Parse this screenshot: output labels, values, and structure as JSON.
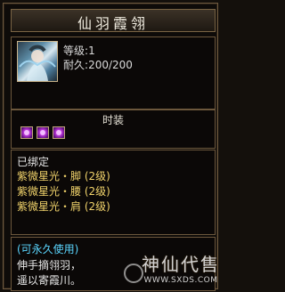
{
  "tooltip": {
    "title": "仙羽霞翎",
    "level_label": "等级",
    "level_value": "1",
    "durability_label": "耐久",
    "durability_value": "200/200",
    "fashion_label": "时装",
    "bound_text": "已绑定",
    "set_items": [
      "紫微星光・脚 (2级)",
      "紫微星光・腰 (2级)",
      "紫微星光・肩 (2级)"
    ],
    "permanent_text": "(可永久使用)",
    "desc_line1": "伸手摘翎羽，",
    "desc_line2": "遥以寄霞川。",
    "colors": {
      "bound": "#e6e6e6",
      "set_item": "#f1d36b",
      "permanent": "#5bd6ff",
      "border": "#6c573c"
    }
  },
  "watermark": {
    "main": "神仙代售",
    "url": "WWW.SXDS.COM"
  }
}
